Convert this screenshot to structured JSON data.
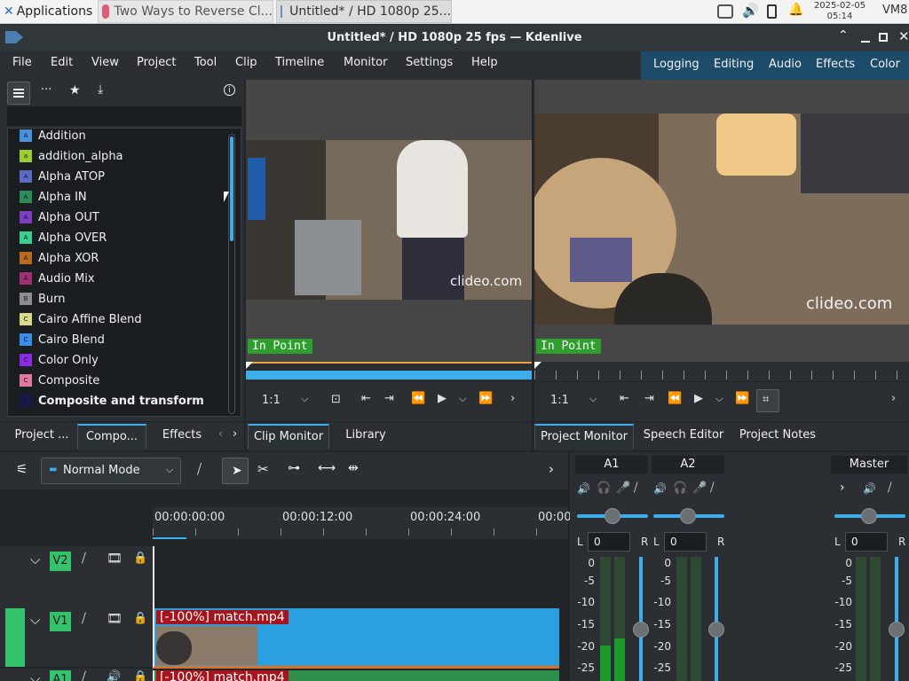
{
  "taskbar": {
    "applications": "Applications",
    "tab1": "Two Ways to Reverse Cl...",
    "tab2": "Untitled* / HD 1080p 25...",
    "date": "2025-02-05",
    "time": "05:14",
    "user": "VM8"
  },
  "window": {
    "title": "Untitled* / HD 1080p 25 fps — Kdenlive"
  },
  "menu": [
    "File",
    "Edit",
    "View",
    "Project",
    "Tool",
    "Clip",
    "Timeline",
    "Monitor",
    "Settings",
    "Help"
  ],
  "workspaces": [
    "Logging",
    "Editing",
    "Audio",
    "Effects",
    "Color"
  ],
  "compositions": [
    {
      "label": "Addition",
      "letter": "A",
      "color": "#4a90d9"
    },
    {
      "label": "addition_alpha",
      "letter": "a",
      "color": "#9acd32"
    },
    {
      "label": "Alpha ATOP",
      "letter": "A",
      "color": "#5b6bbf"
    },
    {
      "label": "Alpha IN",
      "letter": "A",
      "color": "#2e8b57"
    },
    {
      "label": "Alpha OUT",
      "letter": "A",
      "color": "#7b3fbf"
    },
    {
      "label": "Alpha OVER",
      "letter": "A",
      "color": "#3ccf8e"
    },
    {
      "label": "Alpha XOR",
      "letter": "A",
      "color": "#b86a1e"
    },
    {
      "label": "Audio Mix",
      "letter": "A",
      "color": "#a0306e"
    },
    {
      "label": "Burn",
      "letter": "B",
      "color": "#8d8d8d"
    },
    {
      "label": "Cairo Affine Blend",
      "letter": "C",
      "color": "#dcd88a"
    },
    {
      "label": "Cairo Blend",
      "letter": "C",
      "color": "#3a8ee6"
    },
    {
      "label": "Color Only",
      "letter": "C",
      "color": "#8a2be2"
    },
    {
      "label": "Composite",
      "letter": "C",
      "color": "#e07a9a"
    },
    {
      "label": "Composite and transform",
      "letter": "C",
      "color": "#1a1a4a"
    }
  ],
  "left_tabs": [
    "Project ...",
    "Compo...",
    "Effects"
  ],
  "clip_monitor": {
    "in_point": "In Point",
    "zoom": "1:1",
    "watermark": "clideo.com"
  },
  "project_monitor": {
    "in_point": "In Point",
    "zoom": "1:1",
    "watermark": "clideo.com"
  },
  "middle_tabs": [
    "Clip Monitor",
    "Library"
  ],
  "right_tabs": [
    "Project Monitor",
    "Speech Editor",
    "Project Notes"
  ],
  "timeline": {
    "mode": "Normal Mode",
    "ruler": [
      "00:00:00:00",
      "00:00:12:00",
      "00:00:24:00",
      "00:00"
    ],
    "tracks": [
      "V2",
      "V1",
      "A1"
    ],
    "clip_label": "[-100%] match.mp4"
  },
  "mixer": {
    "channels": [
      "A1",
      "A2",
      "Master"
    ],
    "L": "L",
    "R": "R",
    "value": "0",
    "db_scale": [
      "0",
      "-5",
      "-10",
      "-15",
      "-20",
      "-25"
    ]
  },
  "colors": {
    "accent": "#3daee9",
    "in_point_bg": "#2e9e2e",
    "clip_red": "#a8141c",
    "track_green": "#34c26a",
    "workspace_bar": "#1d4c6a"
  }
}
